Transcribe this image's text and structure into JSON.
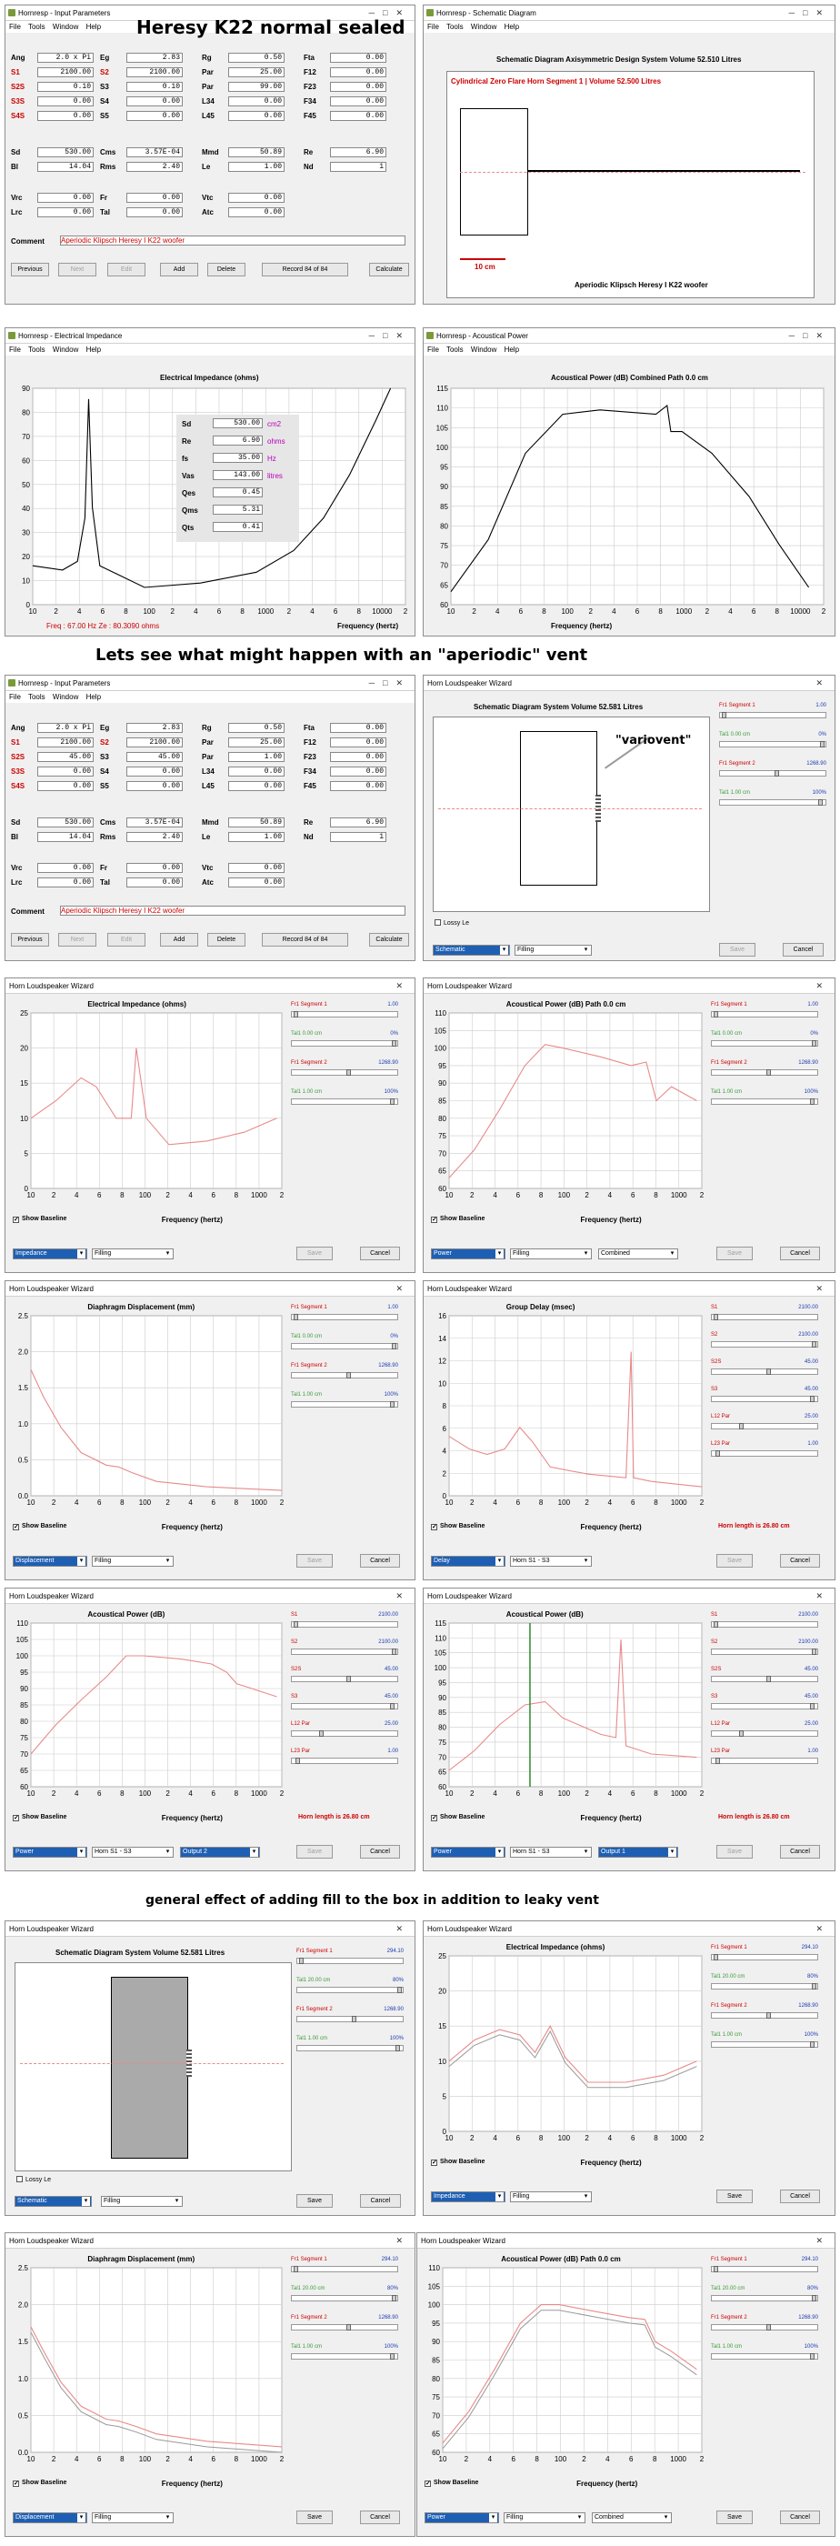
{
  "headings": {
    "h1": "Heresy K22 normal sealed",
    "h2": "Lets see what might happen with an \"aperiodic\" vent",
    "h3": "general effect of adding fill to the box in addition to leaky vent",
    "variovent": "\"variovent\""
  },
  "common": {
    "menu_file": "File",
    "menu_tools": "Tools",
    "menu_window": "Window",
    "menu_help": "Help",
    "wizard_title": "Horn Loudspeaker Wizard",
    "save": "Save",
    "cancel": "Cancel",
    "show_baseline": "Show Baseline",
    "lossy_le": "Lossy Le",
    "freq_axis": "Frequency (hertz)",
    "filling": "Filling",
    "combined": "Combined",
    "horn_s1s3": "Horn S1 - S3",
    "horn_length": "Horn length is 26.80 cm"
  },
  "input_params": {
    "title": "Hornresp - Input Parameters",
    "comment_label": "Comment",
    "comment": "Aperiodic Klipsch Heresy I K22 woofer",
    "buttons": [
      "Previous",
      "Next",
      "Edit",
      "Add",
      "Delete",
      "Record 84 of 84",
      "Calculate"
    ],
    "grid1": [
      [
        "Ang",
        "2.0 x Pi",
        "Eg",
        "2.83",
        "Rg",
        "0.50",
        "Fta",
        "0.00"
      ],
      [
        "S1",
        "2100.00",
        "S2",
        "2100.00",
        "Par",
        "25.00",
        "F12",
        "0.00"
      ],
      [
        "S2S",
        "0.10",
        "S3",
        "0.10",
        "Par",
        "99.00",
        "F23",
        "0.00"
      ],
      [
        "S3S",
        "0.00",
        "S4",
        "0.00",
        "L34",
        "0.00",
        "F34",
        "0.00"
      ],
      [
        "S4S",
        "0.00",
        "S5",
        "0.00",
        "L45",
        "0.00",
        "F45",
        "0.00"
      ]
    ],
    "grid1b": [
      [
        "Ang",
        "2.0 x Pi",
        "Eg",
        "2.83",
        "Rg",
        "0.50",
        "Fta",
        "0.00"
      ],
      [
        "S1",
        "2100.00",
        "S2",
        "2100.00",
        "Par",
        "25.00",
        "F12",
        "0.00"
      ],
      [
        "S2S",
        "45.00",
        "S3",
        "45.00",
        "Par",
        "1.00",
        "F23",
        "0.00"
      ],
      [
        "S3S",
        "0.00",
        "S4",
        "0.00",
        "L34",
        "0.00",
        "F34",
        "0.00"
      ],
      [
        "S4S",
        "0.00",
        "S5",
        "0.00",
        "L45",
        "0.00",
        "F45",
        "0.00"
      ]
    ],
    "grid2": [
      [
        "Sd",
        "530.00",
        "Cms",
        "3.57E-04",
        "Mmd",
        "50.89",
        "Re",
        "6.90"
      ],
      [
        "Bl",
        "14.04",
        "Rms",
        "2.40",
        "Le",
        "1.00",
        "Nd",
        "1"
      ]
    ],
    "grid3": [
      [
        "Vrc",
        "0.00",
        "Fr",
        "0.00",
        "Vtc",
        "0.00"
      ],
      [
        "Lrc",
        "0.00",
        "Tal",
        "0.00",
        "Atc",
        "0.00"
      ]
    ]
  },
  "schem1": {
    "title": "Hornresp - Schematic Diagram",
    "heading": "Schematic Diagram   Axisymmetric Design   System Volume 52.510 Litres",
    "segment": "Cylindrical Zero Flare Horn Segment 1 | Volume 52.500 Litres",
    "scale": "10 cm",
    "caption": "Aperiodic Klipsch Heresy I K22 woofer"
  },
  "imp1": {
    "title": "Hornresp - Electrical Impedance",
    "heading": "Electrical Impedance (ohms)",
    "yt": [
      "90",
      "80",
      "70",
      "60",
      "50",
      "40",
      "30",
      "20",
      "10",
      "0"
    ],
    "xt": [
      "10",
      "2",
      "4",
      "6",
      "8",
      "100",
      "2",
      "4",
      "6",
      "8",
      "1000",
      "2",
      "4",
      "6",
      "8",
      "10000",
      "2"
    ],
    "status": "Freq : 67.00 Hz    Ze : 80.3090 ohms",
    "params": [
      [
        "Sd",
        "530.00",
        "cm2"
      ],
      [
        "Re",
        "6.90",
        "ohms"
      ],
      [
        "fs",
        "35.00",
        "Hz"
      ],
      [
        "Vas",
        "143.00",
        "litres"
      ],
      [
        "Qes",
        "0.45",
        ""
      ],
      [
        "Qms",
        "5.31",
        ""
      ],
      [
        "Qts",
        "0.41",
        ""
      ]
    ]
  },
  "pow1": {
    "title": "Hornresp - Acoustical Power",
    "heading": "Acoustical Power (dB)   Combined   Path 0.0 cm",
    "yt": [
      "115",
      "110",
      "105",
      "100",
      "95",
      "90",
      "85",
      "80",
      "75",
      "70",
      "65",
      "60"
    ],
    "xt": [
      "10",
      "2",
      "4",
      "6",
      "8",
      "100",
      "2",
      "4",
      "6",
      "8",
      "1000",
      "2",
      "4",
      "6",
      "8",
      "10000",
      "2"
    ]
  },
  "schem2": {
    "title": "Horn Loudspeaker Wizard",
    "heading": "Schematic Diagram   System Volume 52.581 Litres",
    "mode": "Schematic"
  },
  "sl_a": [
    [
      "Fr1 Segment 1",
      "1.00"
    ],
    [
      "Tal1 0.00 cm",
      "0%"
    ],
    [
      "Fr1 Segment 2",
      "1268.90"
    ],
    [
      "Tal1 1.00 cm",
      "100%"
    ]
  ],
  "sl_b": [
    [
      "S1",
      "2100.00"
    ],
    [
      "S2",
      "2100.00"
    ],
    [
      "S2S",
      "45.00"
    ],
    [
      "S3",
      "45.00"
    ],
    [
      "L12 Par",
      "25.00"
    ],
    [
      "L23 Par",
      "1.00"
    ]
  ],
  "sl_c": [
    [
      "Fr1 Segment 1",
      "294.10"
    ],
    [
      "Tal1 20.00 cm",
      "80%"
    ],
    [
      "Fr1 Segment 2",
      "1268.90"
    ],
    [
      "Tal1 1.00 cm",
      "100%"
    ]
  ],
  "p_imp2": {
    "heading": "Electrical Impedance (ohms)",
    "yt": [
      "25",
      "20",
      "15",
      "10",
      "5",
      "0"
    ],
    "mode": "Impedance"
  },
  "p_pow2": {
    "heading": "Acoustical Power (dB)   Path 0.0 cm",
    "yt": [
      "110",
      "105",
      "100",
      "95",
      "90",
      "85",
      "80",
      "75",
      "70",
      "65",
      "60"
    ],
    "mode": "Power"
  },
  "p_dis2": {
    "heading": "Diaphragm Displacement (mm)",
    "yt": [
      "2.5",
      "2.0",
      "1.5",
      "1.0",
      "0.5",
      "0.0"
    ],
    "mode": "Displacement"
  },
  "p_del2": {
    "heading": "Group Delay (msec)",
    "yt": [
      "16",
      "14",
      "12",
      "10",
      "8",
      "6",
      "4",
      "2",
      "0"
    ],
    "mode": "Delay"
  },
  "p_pow3": {
    "heading": "Acoustical Power (dB)",
    "yt": [
      "110",
      "105",
      "100",
      "95",
      "90",
      "85",
      "80",
      "75",
      "70",
      "65",
      "60"
    ],
    "mode": "Power",
    "out": "Output 2"
  },
  "p_pow4": {
    "heading": "Acoustical Power (dB)",
    "yt": [
      "115",
      "110",
      "105",
      "100",
      "95",
      "90",
      "85",
      "80",
      "75",
      "70",
      "65",
      "60"
    ],
    "mode": "Power",
    "out": "Output 1"
  },
  "p_imp5": {
    "heading": "Electrical Impedance (ohms)",
    "yt": [
      "25",
      "20",
      "15",
      "10",
      "5",
      "0"
    ],
    "mode": "Impedance"
  },
  "p_dis5": {
    "heading": "Diaphragm Displacement (mm)",
    "yt": [
      "2.5",
      "2.0",
      "1.5",
      "1.0",
      "0.5",
      "0.0"
    ],
    "mode": "Displacement"
  },
  "p_pow5": {
    "heading": "Acoustical Power (dB)   Path 0.0 cm",
    "yt": [
      "110",
      "105",
      "100",
      "95",
      "90",
      "85",
      "80",
      "75",
      "70",
      "65",
      "60"
    ],
    "mode": "Power"
  },
  "schem3": {
    "heading": "Schematic Diagram   System Volume 52.581 Litres",
    "mode": "Schematic"
  },
  "xt_short": [
    "10",
    "2",
    "4",
    "6",
    "8",
    "100",
    "2",
    "4",
    "6",
    "8",
    "1000",
    "2"
  ],
  "colors": {
    "curve": "#e88a8a",
    "black": "#000000",
    "green": "#2e8b2e",
    "label_red": "#cc0000",
    "value_blue": "#1a3ab0"
  }
}
